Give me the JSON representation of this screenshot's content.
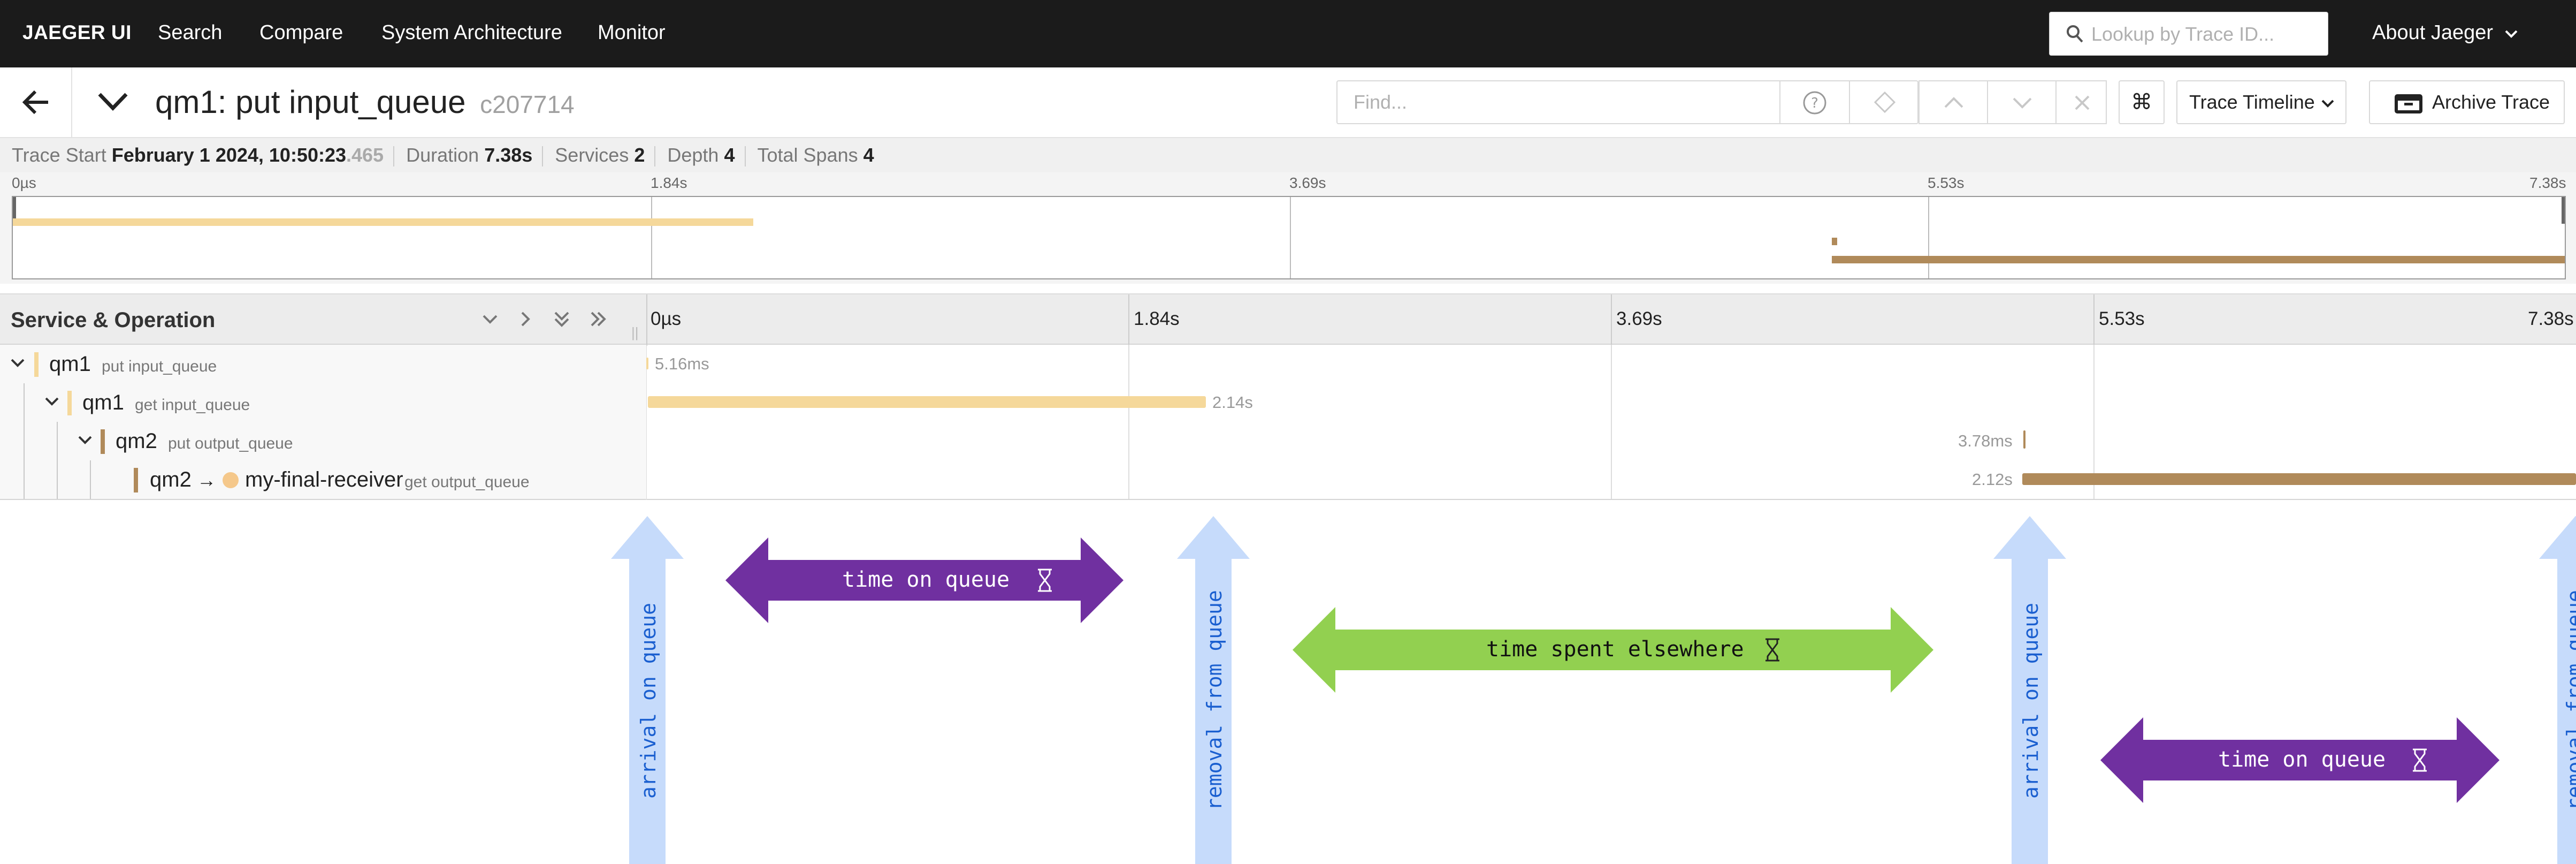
{
  "nav": {
    "brand": "JAEGER UI",
    "links": [
      "Search",
      "Compare",
      "System Architecture",
      "Monitor"
    ],
    "lookup_placeholder": "Lookup by Trace ID...",
    "about": "About Jaeger"
  },
  "trace": {
    "service": "qm1:",
    "operation": "put input_queue",
    "trace_id": "c207714",
    "find_placeholder": "Find...",
    "kbd_symbol": "⌘",
    "view_mode": "Trace Timeline",
    "archive_label": "Archive Trace"
  },
  "summary": {
    "trace_start_label": "Trace Start",
    "trace_start_value": "February 1 2024, 10:50:23",
    "trace_start_ms": ".465",
    "duration_label": "Duration",
    "duration_value": "7.38s",
    "services_label": "Services",
    "services_value": "2",
    "depth_label": "Depth",
    "depth_value": "4",
    "total_spans_label": "Total Spans",
    "total_spans_value": "4"
  },
  "timeline": {
    "ticks": [
      "0µs",
      "1.84s",
      "3.69s",
      "5.53s",
      "7.38s"
    ],
    "column_title": "Service & Operation"
  },
  "spans": [
    {
      "service": "qm1",
      "operation": "put input_queue",
      "duration_label": "5.16ms",
      "color": "#f5d89a",
      "start_frac": 0.0,
      "end_frac": 0.0007
    },
    {
      "service": "qm1",
      "operation": "get input_queue",
      "duration_label": "2.14s",
      "color": "#f5d89a",
      "start_frac": 0.0007,
      "end_frac": 0.29
    },
    {
      "service": "qm2",
      "operation": "put output_queue",
      "duration_label": "3.78ms",
      "color": "#b08a5a",
      "start_frac": 0.7135,
      "end_frac": 0.714
    },
    {
      "service": "qm2",
      "operation": "get output_queue",
      "peer": "my-final-receiver",
      "duration_label": "2.12s",
      "color": "#b08a5a",
      "start_frac": 0.713,
      "end_frac": 1.0
    }
  ],
  "annotations": {
    "arrival_1": "arrival on queue",
    "removal_1": "removal from queue",
    "arrival_2": "arrival on queue",
    "removal_2": "removal from queue",
    "time_on_queue_1": "time on queue",
    "time_elsewhere": "time spent elsewhere",
    "time_on_queue_2": "time on queue",
    "colors": {
      "purple": "#7030a0",
      "green": "#92d050",
      "blue_arrow": "#c6dbfb",
      "blue_text": "#1a5fd0"
    }
  }
}
